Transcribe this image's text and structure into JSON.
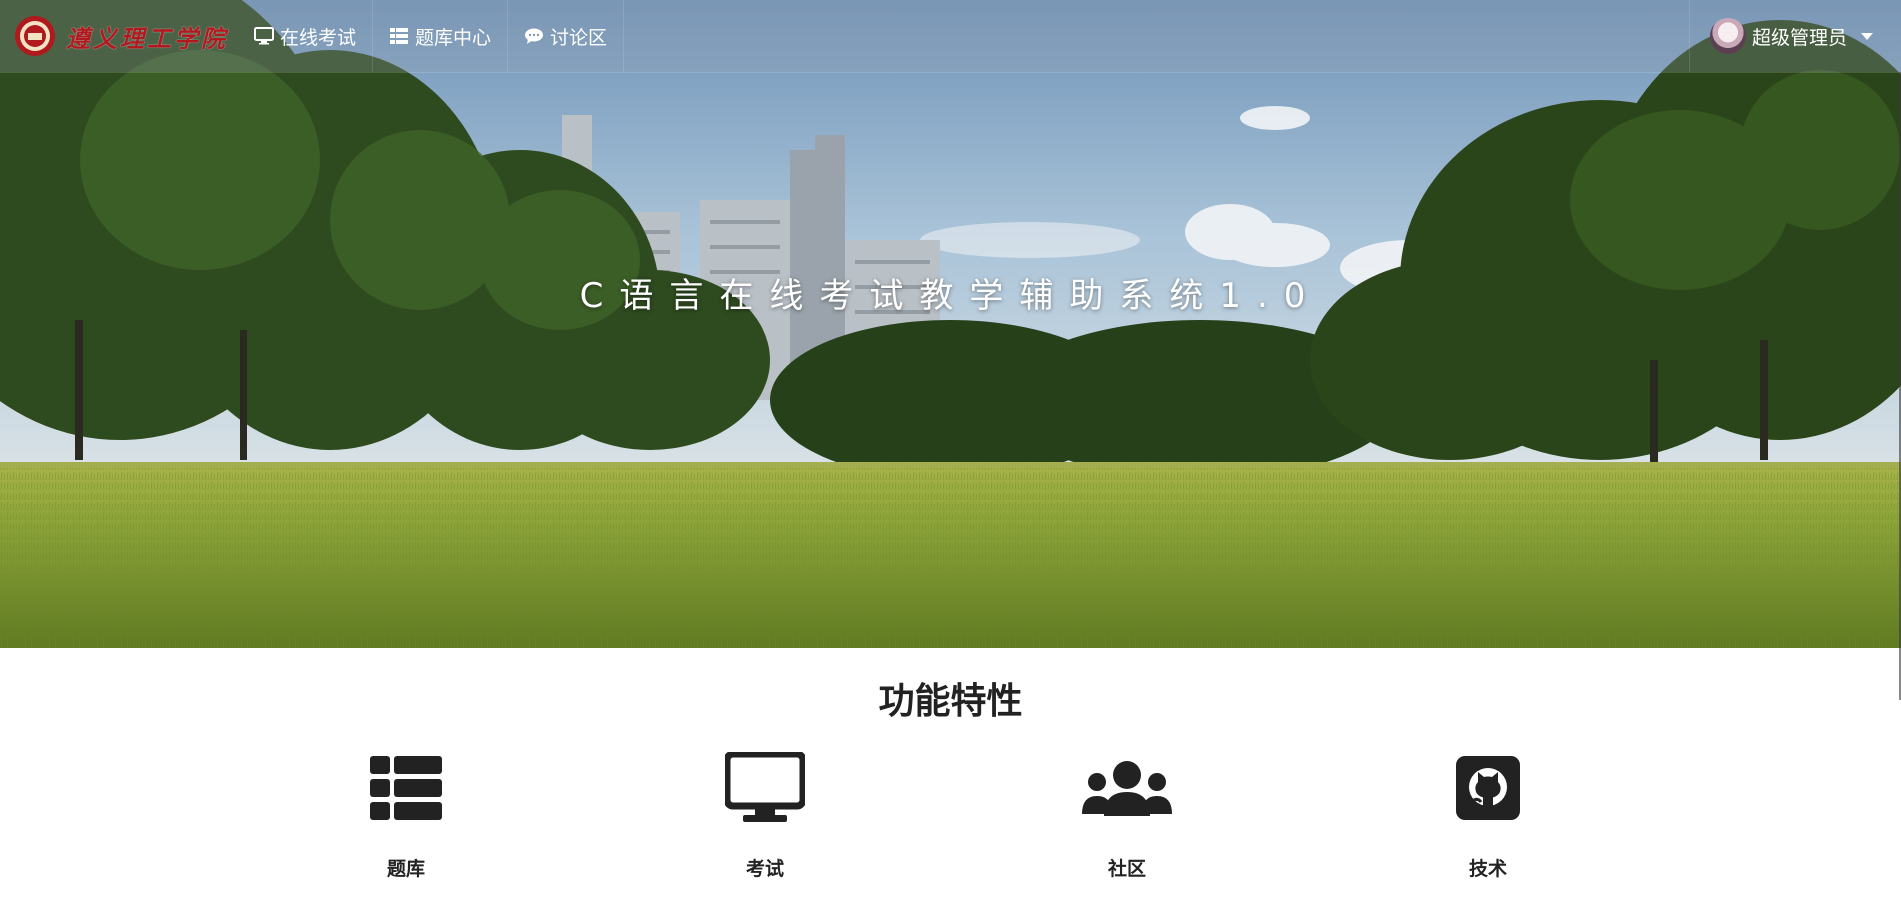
{
  "navbar": {
    "brand_text": "遵义理工学院",
    "items": [
      {
        "label": "在线考试",
        "icon": "monitor-icon"
      },
      {
        "label": "题库中心",
        "icon": "list-icon"
      },
      {
        "label": "讨论区",
        "icon": "comment-icon"
      }
    ],
    "user": {
      "name": "超级管理员",
      "avatar": "avatar"
    }
  },
  "hero": {
    "title": "C语言在线考试教学辅助系统1.0"
  },
  "features": {
    "title": "功能特性",
    "items": [
      {
        "label": "题库",
        "icon": "list-icon"
      },
      {
        "label": "考试",
        "icon": "monitor-icon"
      },
      {
        "label": "社区",
        "icon": "users-icon"
      },
      {
        "label": "技术",
        "icon": "github-icon"
      }
    ]
  },
  "colors": {
    "brand_red": "#b0191e",
    "grass": "#7f9a2c",
    "sky": "#8fb3cf",
    "text_dark": "#222222"
  }
}
